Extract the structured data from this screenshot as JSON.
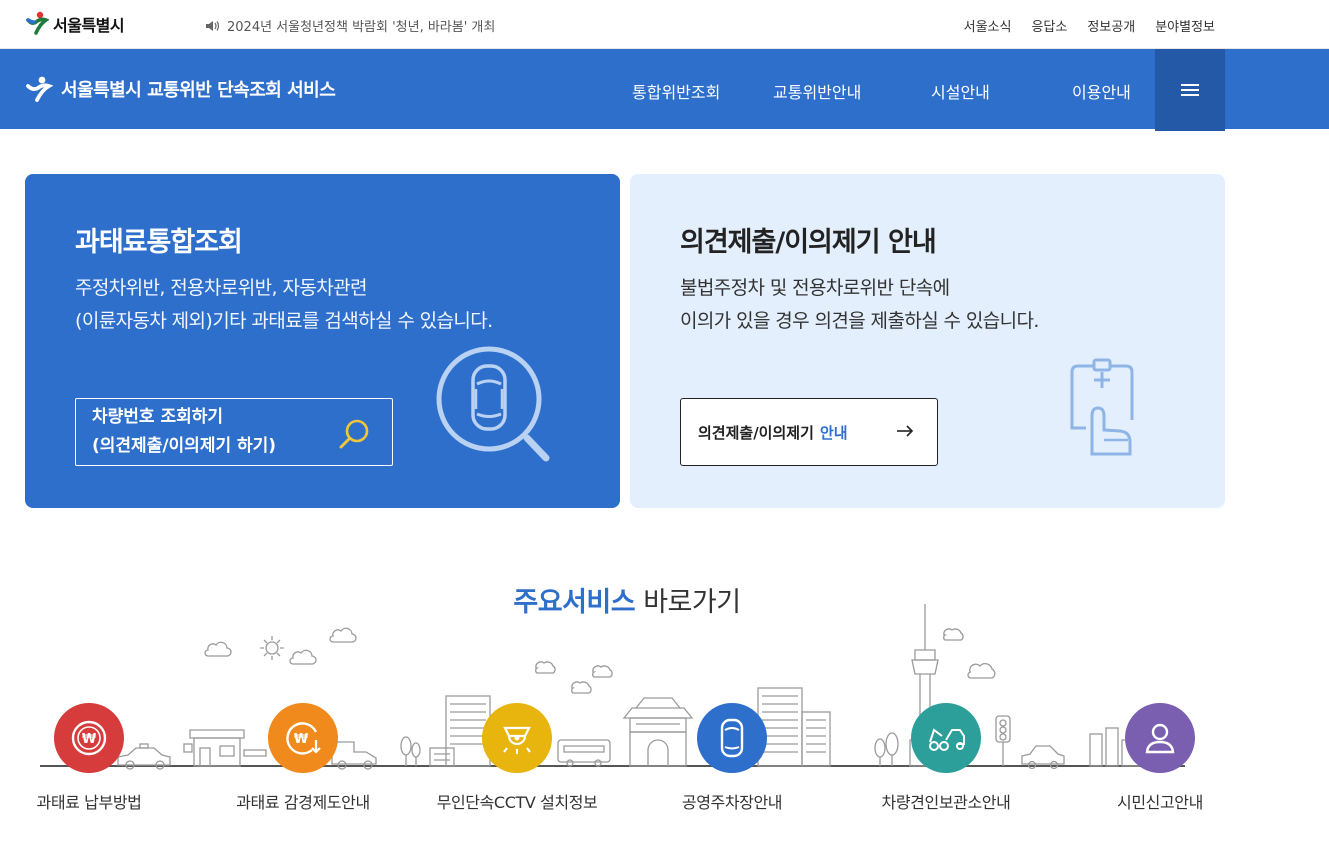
{
  "header": {
    "logo_text": "서울특별시",
    "notice": "2024년 서울청년정책 박람회 '청년, 바라봄' 개최",
    "top_links": [
      "서울소식",
      "응답소",
      "정보공개",
      "분야별정보"
    ]
  },
  "nav": {
    "brand": "서울특별시 교통위반 단속조회 서비스",
    "menu": [
      "통합위반조회",
      "교통위반안내",
      "시설안내",
      "이용안내"
    ]
  },
  "card_search": {
    "title": "과태료통합조회",
    "desc_line1": "주정차위반, 전용차로위반, 자동차관련",
    "desc_line2": "(이륜자동차 제외)기타 과태료를 검색하실 수 있습니다.",
    "button_line1": "차량번호 조회하기",
    "button_line2": "(의견제출/이의제기 하기)"
  },
  "card_opinion": {
    "title": "의견제출/이의제기 안내",
    "desc_line1": "불법주정차 및 전용차로위반 단속에",
    "desc_line2": "이의가 있을 경우 의견을 제출하실 수 있습니다.",
    "button_main": "의견제출/이의제기",
    "button_highlight": "안내"
  },
  "services": {
    "title_strong": "주요서비스",
    "title_rest": "바로가기",
    "items": [
      {
        "label": "과태료 납부방법",
        "color": "#d63c3c",
        "icon": "won-coin-icon"
      },
      {
        "label": "과태료 감경제도안내",
        "color": "#f08a1c",
        "icon": "won-discount-icon"
      },
      {
        "label": "무인단속CCTV 설치정보",
        "color": "#e8b40e",
        "icon": "cctv-icon"
      },
      {
        "label": "공영주차장안내",
        "color": "#2e6fcc",
        "icon": "car-top-icon"
      },
      {
        "label": "차량견인보관소안내",
        "color": "#2d9f9b",
        "icon": "tow-truck-icon"
      },
      {
        "label": "시민신고안내",
        "color": "#7a5fb0",
        "icon": "person-icon"
      }
    ]
  }
}
